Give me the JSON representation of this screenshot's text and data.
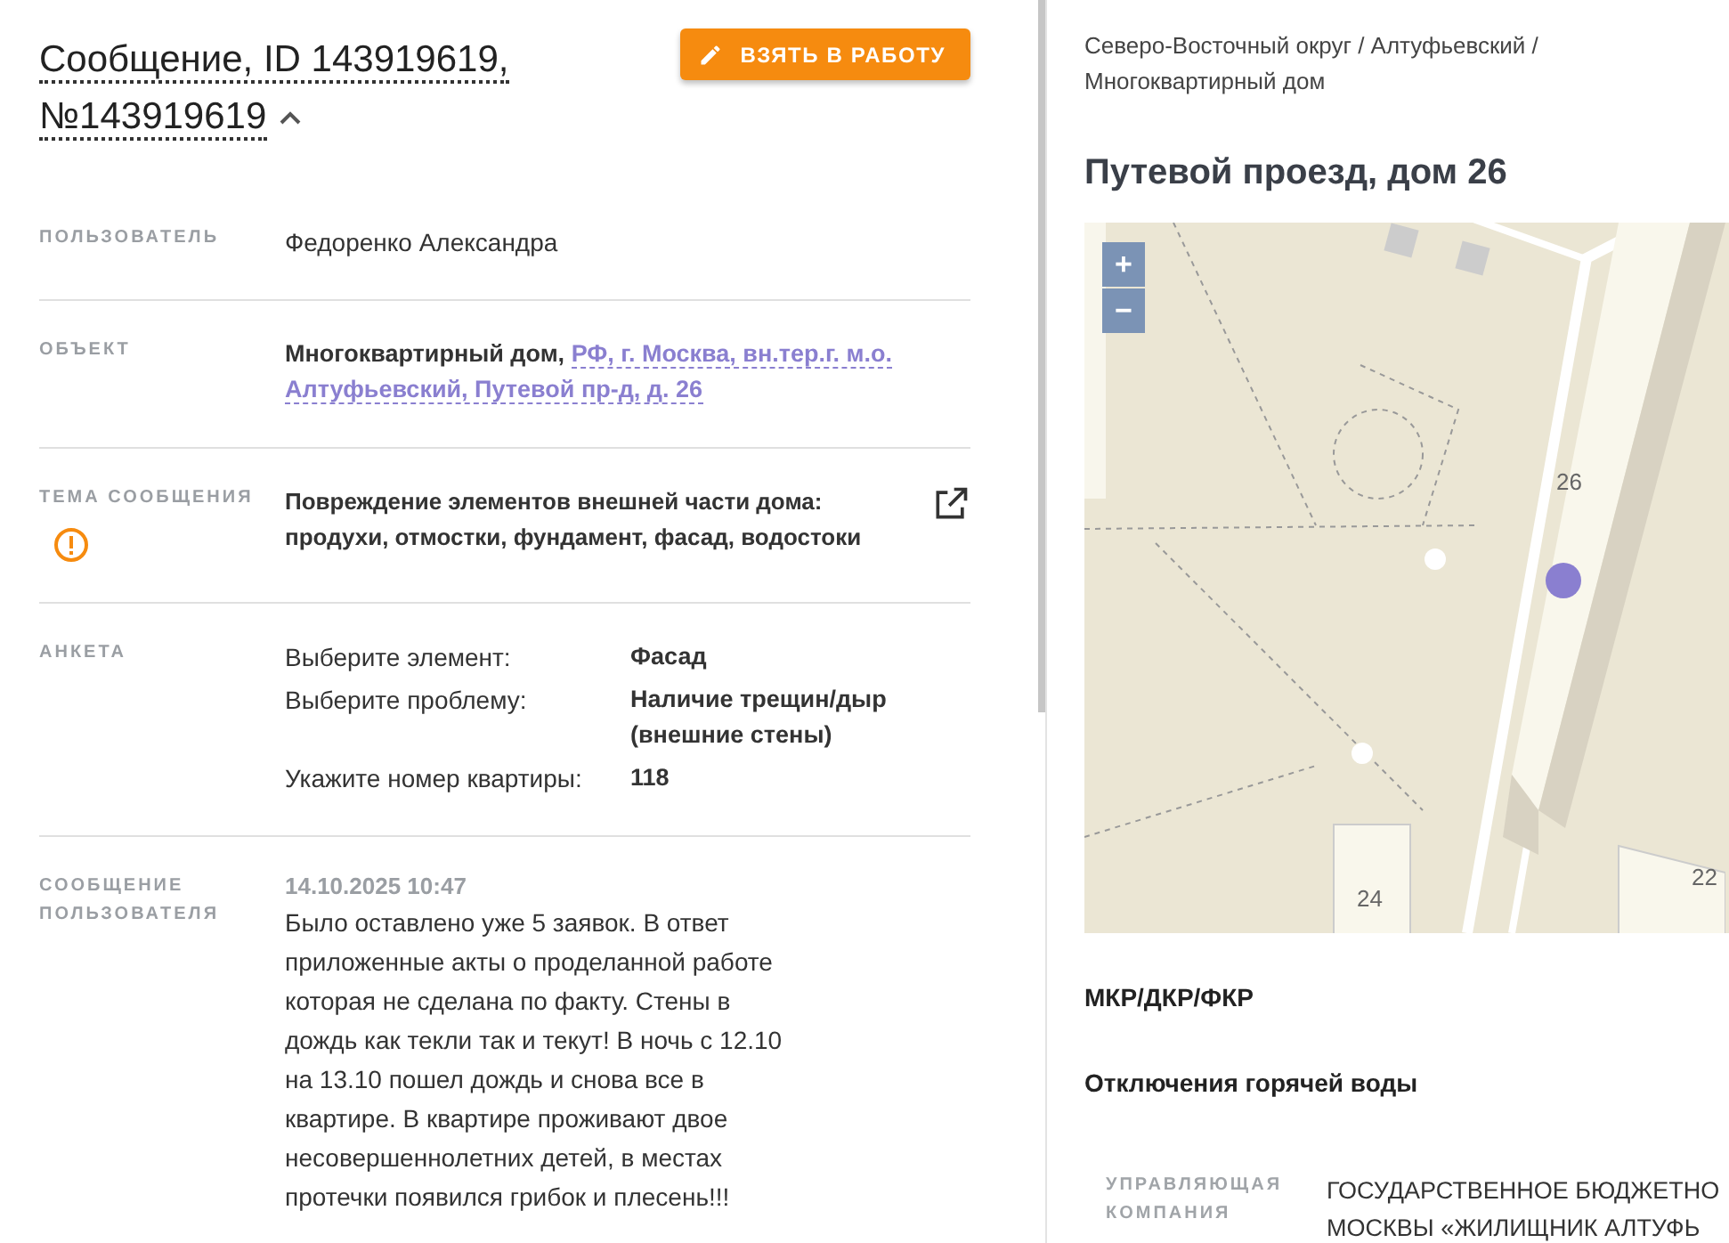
{
  "message": {
    "title_lines": [
      "Сообщение, ID 143919619,",
      "№143919619"
    ],
    "expanded": true,
    "action_button": "ВЗЯТЬ В РАБОТУ"
  },
  "fields": [
    {
      "kind": "text",
      "label": "ПОЛЬЗОВАТЕЛЬ",
      "value": "Федоренко Александра"
    },
    {
      "kind": "object",
      "label": "ОБЪЕКТ",
      "value": "Многоквартирный дом,",
      "link_lines": [
        "РФ, г. Москва, вн.тер.г. м.о.",
        "Алтуфьевский, Путевой пр-д, д. 26"
      ]
    },
    {
      "kind": "topic",
      "label": "ТЕМА СООБЩЕНИЯ",
      "value": "Повреждение элементов внешней части дома: продухи, отмостки, фундамент, фасад, водостоки",
      "warning": true
    },
    {
      "kind": "survey",
      "label": "АНКЕТА",
      "items": [
        {
          "question": "Выберите элемент:",
          "answer": "Фасад"
        },
        {
          "question": "Выберите проблему:",
          "answer": "Наличие трещин/дыр (внешние стены)"
        },
        {
          "question": "Укажите номер квартиры:",
          "answer": "118"
        }
      ]
    },
    {
      "kind": "comment",
      "label": "СООБЩЕНИЕ ПОЛЬЗОВАТЕЛЯ",
      "date": "14.10.2025 10:47",
      "value": "Было оставлено уже 5 заявок. В ответ приложенные акты о проделанной работе которая не сделана по факту. Стены в дождь как текли так и текут! В ночь с 12.10 на 13.10 пошел дождь и снова все в квартире. В квартире проживают двое несовершеннолетних детей, в местах протечки появился грибок и плесень!!!"
    }
  ],
  "building": {
    "breadcrumb": "Северо-Восточный округ / Алтуфьевский / Многоквартирный дом",
    "title": "Путевой проезд, дом 26",
    "map": {
      "zoom_in": "+",
      "zoom_out": "−",
      "labels": [
        "26",
        "24",
        "22"
      ]
    },
    "sections": [
      "МКР/ДКР/ФКР",
      "Отключения горячей воды"
    ],
    "info": [
      {
        "label": "УПРАВЛЯЮЩАЯ КОМПАНИЯ",
        "value_lines": [
          "ГОСУДАРСТВЕННОЕ БЮДЖЕТНО",
          "МОСКВЫ «ЖИЛИЩНИК АЛТУФЬ"
        ]
      }
    ]
  }
}
